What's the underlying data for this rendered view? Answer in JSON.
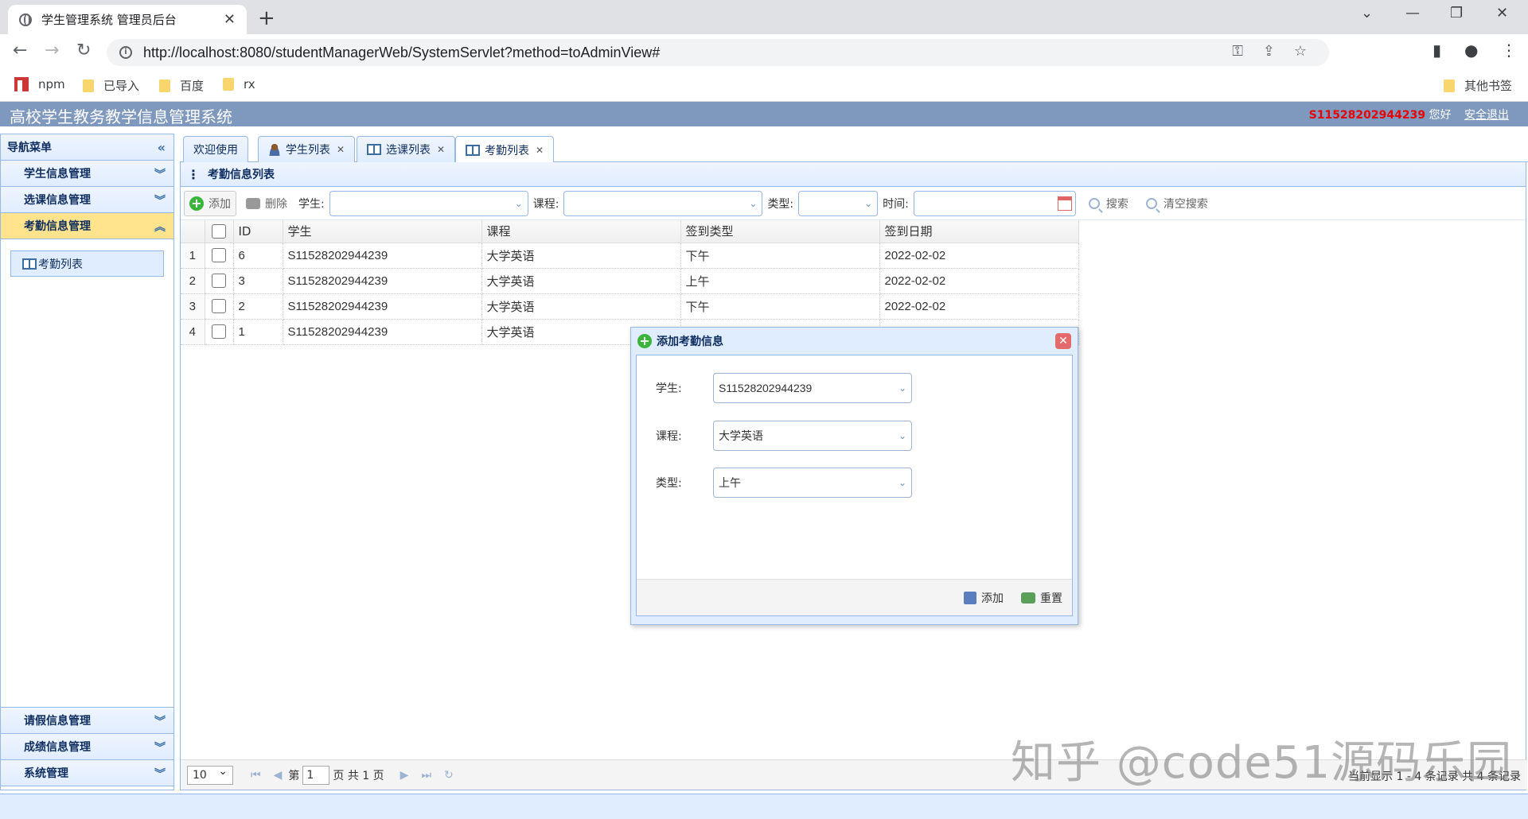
{
  "browser": {
    "tab_title": "学生管理系统 管理员后台",
    "url": "http://localhost:8080/studentManagerWeb/SystemServlet?method=toAdminView#",
    "bookmarks": [
      "npm",
      "已导入",
      "百度",
      "rx"
    ],
    "other_bookmarks": "其他书签"
  },
  "header": {
    "title": "高校学生教务教学信息管理系统",
    "user_id": "S11528202944239",
    "greeting": "您好",
    "logout": "安全退出"
  },
  "sidebar": {
    "title": "导航菜单",
    "sections_top": [
      "学生信息管理",
      "选课信息管理",
      "考勤信息管理"
    ],
    "active_item": "考勤列表",
    "sections_bottom": [
      "请假信息管理",
      "成绩信息管理",
      "系统管理"
    ]
  },
  "tabs": [
    "欢迎使用",
    "学生列表",
    "选课列表",
    "考勤列表"
  ],
  "panel": {
    "title": "考勤信息列表"
  },
  "toolbar": {
    "add": "添加",
    "delete": "删除",
    "student_label": "学生:",
    "course_label": "课程:",
    "type_label": "类型:",
    "time_label": "时间:",
    "search": "搜索",
    "clear": "清空搜索"
  },
  "grid": {
    "columns": [
      "ID",
      "学生",
      "课程",
      "签到类型",
      "签到日期"
    ],
    "rows": [
      {
        "rn": "1",
        "id": "6",
        "student": "S11528202944239",
        "course": "大学英语",
        "type": "下午",
        "date": "2022-02-02"
      },
      {
        "rn": "2",
        "id": "3",
        "student": "S11528202944239",
        "course": "大学英语",
        "type": "上午",
        "date": "2022-02-02"
      },
      {
        "rn": "3",
        "id": "2",
        "student": "S11528202944239",
        "course": "大学英语",
        "type": "下午",
        "date": "2022-02-02"
      },
      {
        "rn": "4",
        "id": "1",
        "student": "S11528202944239",
        "course": "大学英语",
        "type": "",
        "date": ""
      }
    ]
  },
  "pager": {
    "page_size": "10",
    "page_prefix": "第",
    "page_value": "1",
    "page_suffix": "页 共 1 页",
    "info": "当前显示 1 - 4 条记录 共 4 条记录"
  },
  "dialog": {
    "title": "添加考勤信息",
    "student_label": "学生:",
    "student_value": "S11528202944239",
    "course_label": "课程:",
    "course_value": "大学英语",
    "type_label": "类型:",
    "type_value": "上午",
    "add": "添加",
    "reset": "重置"
  },
  "watermark": "知乎 @code51源码乐园"
}
